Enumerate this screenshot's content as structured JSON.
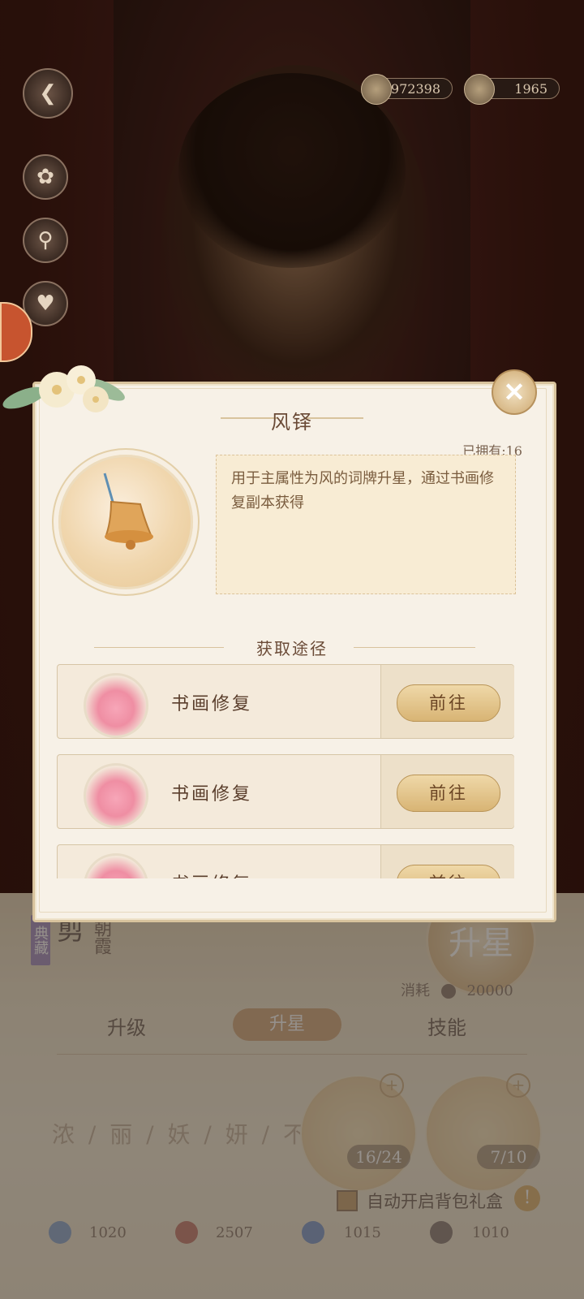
{
  "top_bar": {
    "currency_jade": "972398",
    "currency_gold": "1965"
  },
  "modal": {
    "title": "风铎",
    "owned": "已拥有:16",
    "description": "用于主属性为风的词牌升星，通过书画修复副本获得",
    "section_title": "获取途径",
    "sources": [
      {
        "label": "书画修复",
        "button": "前往"
      },
      {
        "label": "书画修复",
        "button": "前往"
      },
      {
        "label": "书画修复",
        "button": "前往"
      }
    ]
  },
  "page": {
    "tag": "典藏",
    "name_main": "剪",
    "name_sub": "朝霞",
    "star_button": "升星",
    "cost_label": "消耗",
    "cost_value": "20000",
    "tabs": [
      "升级",
      "升星",
      "技能"
    ],
    "poem": "浓 / 丽 / 妖 / 妍 / 不",
    "slots": [
      {
        "count": "16/24"
      },
      {
        "count": "7/10"
      }
    ],
    "auto_open_label": "自动开启背包礼盒",
    "stats": [
      "1020",
      "2507",
      "1015",
      "1010"
    ]
  }
}
